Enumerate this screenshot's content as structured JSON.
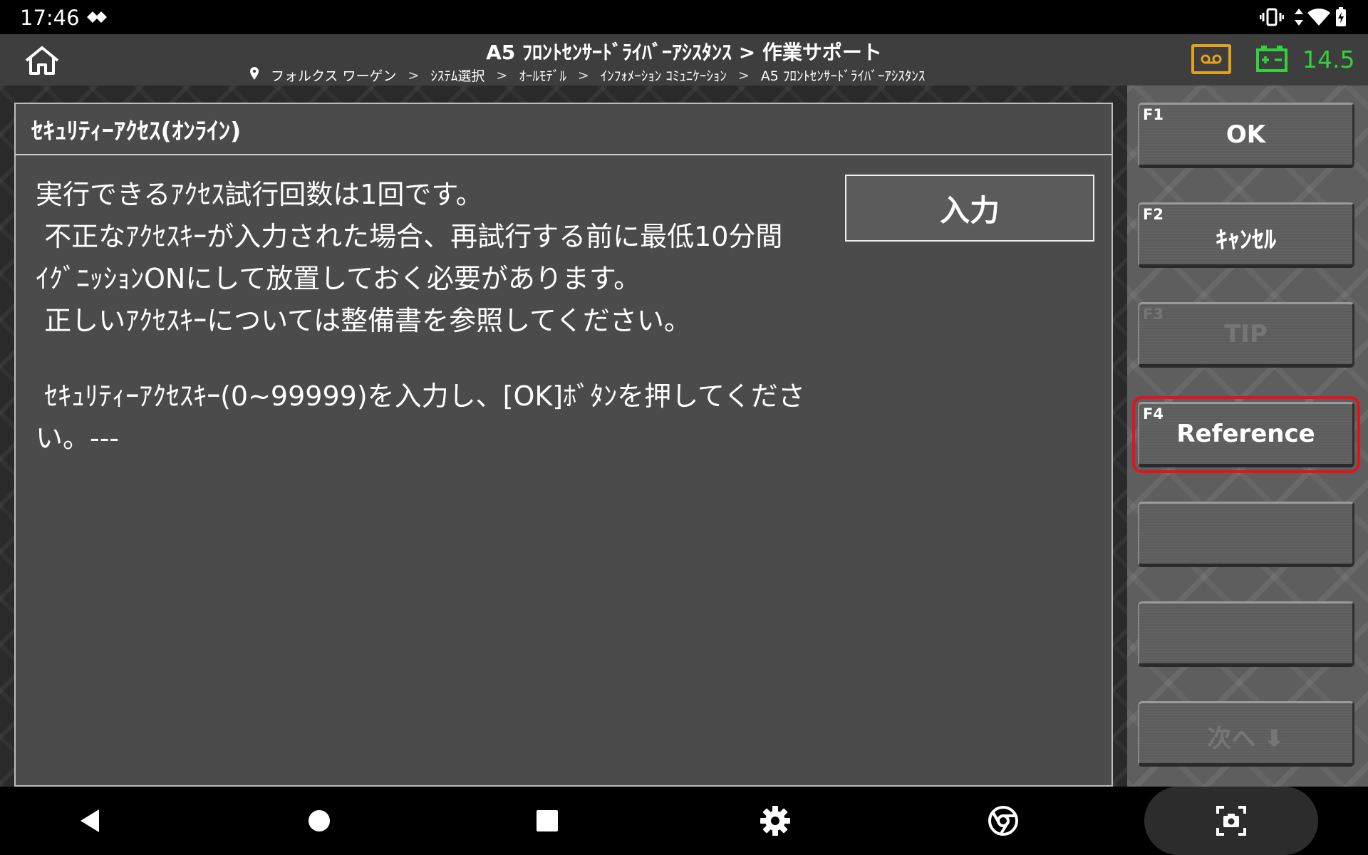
{
  "status_bar": {
    "time": "17:46",
    "icons": [
      "app-diamond-icon",
      "vibrate-icon",
      "data-arrows-icon",
      "wifi-icon",
      "battery-charging-icon"
    ]
  },
  "header": {
    "title": "A5 ﾌﾛﾝﾄｾﾝｻｰﾄﾞﾗｲﾊﾞｰｱｼｽﾀﾝｽ > 作業サポート",
    "breadcrumb": [
      "フォルクス ワーゲン",
      "ｼｽﾃﾑ選択",
      "ｵｰﾙﾓﾃﾞﾙ",
      "ｲﾝﾌｫﾒｰｼｮﾝ ｺﾐｭﾆｹｰｼｮﾝ",
      "A5 ﾌﾛﾝﾄｾﾝｻｰﾄﾞﾗｲﾊﾞｰｱｼｽﾀﾝｽ"
    ],
    "separator": ">",
    "voltage": "14.5",
    "colors": {
      "recorder": "#e5a11a",
      "battery": "#32d23c"
    }
  },
  "dialog": {
    "title": "ｾｷｭﾘﾃｨｰｱｸｾｽ(ｵﾝﾗｲﾝ)",
    "lines": [
      "実行できるｱｸｾｽ試行回数は1回です。",
      " 不正なｱｸｾｽｷｰが入力された場合、再試行する前に最低10分間",
      "ｲｸﾞﾆｯｼｮﾝONにして放置しておく必要があります。",
      " 正しいｱｸｾｽｷｰについては整備書を参照してください。"
    ],
    "instruction": " ｾｷｭﾘﾃｨｰｱｸｾｽｷｰ(0~99999)を入力し、[OK]ﾎﾞﾀﾝを押してください。---",
    "input_button": "入力"
  },
  "function_keys": [
    {
      "key": "F1",
      "label": "OK",
      "enabled": true
    },
    {
      "key": "F2",
      "label": "ｷｬﾝｾﾙ",
      "enabled": true
    },
    {
      "key": "F3",
      "label": "TIP",
      "enabled": false
    },
    {
      "key": "F4",
      "label": "Reference",
      "enabled": true,
      "highlighted": true
    },
    {
      "key": "",
      "label": "",
      "enabled": false
    },
    {
      "key": "",
      "label": "",
      "enabled": false
    },
    {
      "key": "",
      "label": "次へ ⬇",
      "enabled": false
    }
  ],
  "nav_bar": [
    "back-icon",
    "home-icon",
    "recents-icon",
    "settings-icon",
    "chrome-icon",
    "screenshot-icon"
  ]
}
